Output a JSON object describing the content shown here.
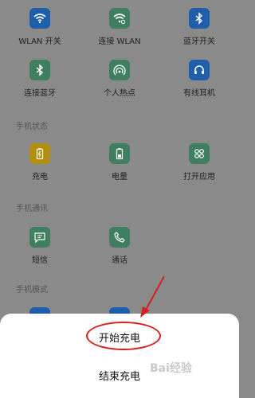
{
  "grid": {
    "row1": [
      {
        "label": "WLAN 开关",
        "icon": "wifi-icon"
      },
      {
        "label": "连接 WLAN",
        "icon": "wifi-connect-icon"
      },
      {
        "label": "蓝牙开关",
        "icon": "bluetooth-icon"
      }
    ],
    "row2": [
      {
        "label": "连接蓝牙",
        "icon": "bluetooth-connect-icon"
      },
      {
        "label": "个人热点",
        "icon": "hotspot-icon"
      },
      {
        "label": "有线耳机",
        "icon": "headset-icon"
      }
    ]
  },
  "sections": {
    "phone_status": {
      "title": "手机状态",
      "items": [
        {
          "label": "充电",
          "icon": "charging-icon"
        },
        {
          "label": "电量",
          "icon": "battery-icon"
        },
        {
          "label": "打开应用",
          "icon": "apps-icon"
        }
      ]
    },
    "phone_comm": {
      "title": "手机通讯",
      "items": [
        {
          "label": "短信",
          "icon": "message-icon"
        },
        {
          "label": "通话",
          "icon": "phone-icon"
        }
      ]
    },
    "phone_mode": {
      "title": "手机模式"
    }
  },
  "sheet": {
    "options": [
      "开始充电",
      "结束充电"
    ]
  },
  "watermark": "Bai经验",
  "colors": {
    "dim_background": "#8a8a8a",
    "blue_tile": "#1f5ea8",
    "green_tile": "#3f7f5f",
    "yellow_tile": "#b38f10",
    "annotation_red": "#d62020"
  }
}
